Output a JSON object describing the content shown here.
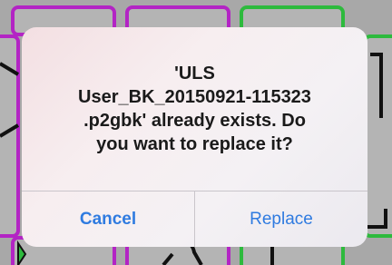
{
  "alert": {
    "message_lines": [
      "'ULS",
      "User_BK_20150921-115323",
      ".p2gbk' already exists. Do",
      "you want to replace it?"
    ],
    "cancel_label": "Cancel",
    "replace_label": "Replace"
  },
  "colors": {
    "accent": "#2f7be0",
    "text": "#1a1a1a",
    "card_magenta": "#b324c4",
    "card_green": "#2dba3d"
  }
}
